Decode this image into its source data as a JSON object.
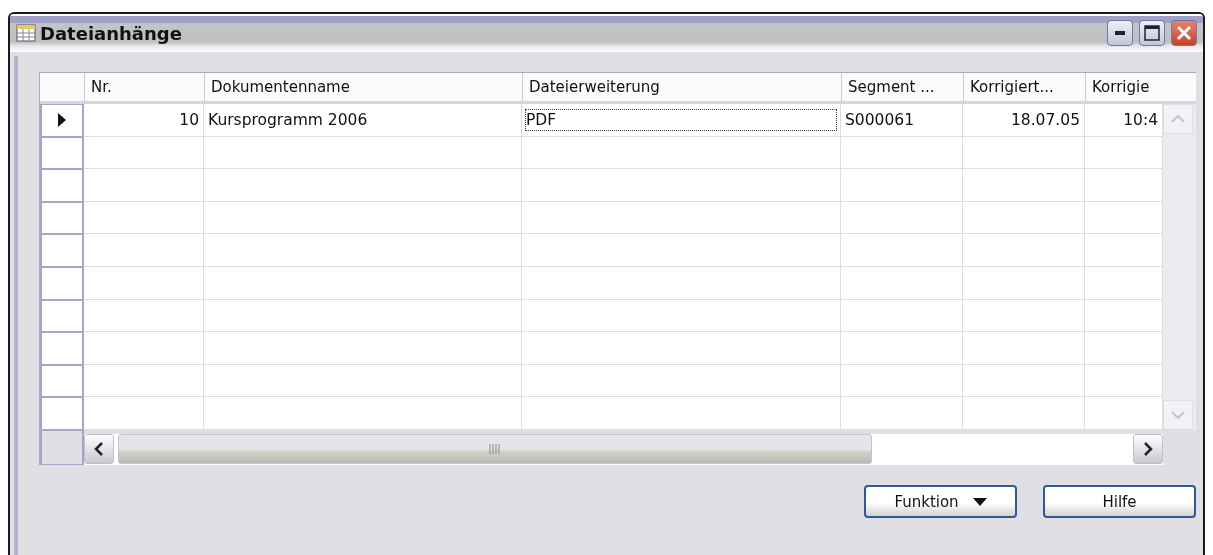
{
  "window": {
    "title": "Dateianhänge"
  },
  "table": {
    "columns": [
      "Nr.",
      "Dokumentenname",
      "Dateierweiterung",
      "Segment ...",
      "Korrigiert...",
      "Korrigie"
    ],
    "rows": [
      {
        "selected": true,
        "cells": [
          {
            "text": "10",
            "focused": false
          },
          {
            "text": "Kursprogramm 2006",
            "focused": false
          },
          {
            "text": "PDF",
            "focused": true
          },
          {
            "text": "S000061",
            "focused": false
          },
          {
            "text": "18.07.05",
            "focused": false
          },
          {
            "text": "10:4",
            "focused": false
          }
        ]
      }
    ]
  },
  "buttons": [
    {
      "label": "Funktion",
      "kind": "menu"
    },
    {
      "label": "Hilfe",
      "kind": "plain"
    }
  ]
}
